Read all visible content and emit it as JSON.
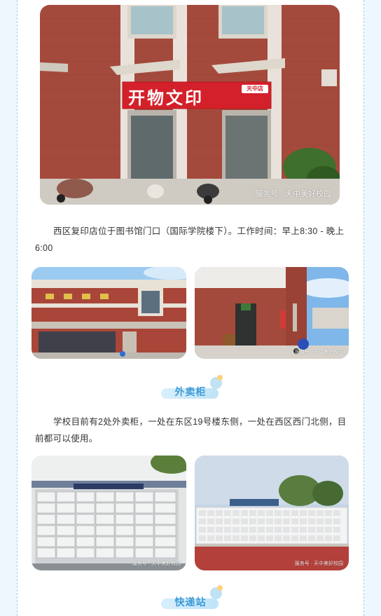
{
  "photos": {
    "storefront": {
      "sign_text": "开物文印",
      "sign_badge": "天中店",
      "watermark": "服务号 · 天中美好校园"
    },
    "library_exterior": {
      "watermark": ""
    },
    "entrance": {
      "watermark": "服务号 · 天中美好校园"
    },
    "locker_left": {
      "watermark": "服务号 · 天中美好校园"
    },
    "locker_right": {
      "watermark": "服务号 · 天中美好校园"
    }
  },
  "print_shop": {
    "description": "西区复印店位于图书馆门口（国际学院楼下）。工作时间：早上8:30 - 晚上6:00"
  },
  "sections": {
    "takeout": {
      "heading": "外卖柜",
      "description": "学校目前有2处外卖柜，一处在东区19号楼东侧，一处在西区西门北侧，目前都可以使用。"
    },
    "express": {
      "heading": "快递站"
    }
  },
  "colors": {
    "heading_text": "#3c9ad6",
    "heading_bar": "#cfeafb",
    "page_bg": "#eef7fd",
    "brick": "#a8463a",
    "sign_red": "#d4202a"
  }
}
